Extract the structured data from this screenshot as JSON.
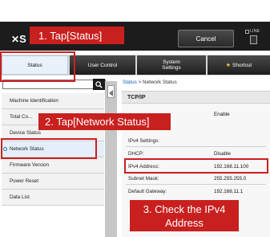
{
  "header": {
    "logo_text": "S",
    "cancel_label": "Cancel",
    "line_label": "LINE"
  },
  "tabs": [
    {
      "label": "Status"
    },
    {
      "label": "User Control"
    },
    {
      "label": "System\nSettings"
    },
    {
      "label": "Shortcut"
    }
  ],
  "sidebar": {
    "items": [
      {
        "label": "Machine Identification"
      },
      {
        "label": "Total Co..."
      },
      {
        "label": "Device Status"
      },
      {
        "label": "Network Status"
      },
      {
        "label": "Firmware Version"
      },
      {
        "label": "Power Reset"
      },
      {
        "label": "Data List"
      }
    ]
  },
  "breadcrumb": {
    "parent": "Status",
    "separator": ">",
    "current": "Network Status"
  },
  "section": {
    "title": "TCP/IP"
  },
  "details": {
    "enable_value": "Enable",
    "ipv4_settings_label": "IPv4 Settings:",
    "dhcp_label": "DHCP:",
    "dhcp_value": "Disable",
    "ipv4_address_label": "IPv4 Address:",
    "ipv4_address_value": "192.168.11.100",
    "subnet_label": "Subnet Mask:",
    "subnet_value": "255.255.255.0",
    "gateway_label": "Default Gateway:",
    "gateway_value": "192.168.11.1"
  },
  "callouts": {
    "step1": "1. Tap[Status]",
    "step2": "2. Tap[Network Status]",
    "step3_line1": "3. Check the IPv4",
    "step3_line2": "Address"
  },
  "colors": {
    "callout_red": "#c8201f",
    "header_black": "#1c1c1c"
  }
}
